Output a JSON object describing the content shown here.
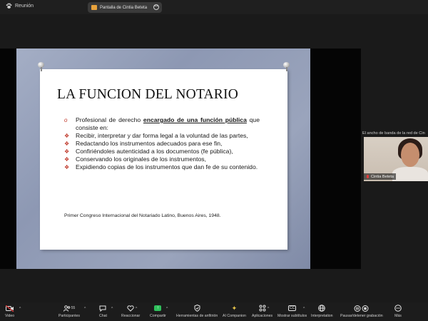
{
  "topbar": {
    "meeting_title": "Reunión",
    "share_label": "Pantalla de Cintia Beteta"
  },
  "slide": {
    "title": "LA FUNCION DEL NOTARIO",
    "bullets": [
      {
        "marker": "o",
        "pre": "Profesional de derecho ",
        "bold": "encargado de una función pública",
        "post": " que consiste en:"
      },
      {
        "marker": "❖",
        "text": "Recibir, interpretar y dar forma legal a la voluntad de las partes,"
      },
      {
        "marker": "❖",
        "text": "Redactando los instrumentos adecuados para ese fin,"
      },
      {
        "marker": "❖",
        "text": "Confiriéndoles autenticidad a los documentos (fe pública),"
      },
      {
        "marker": "❖",
        "text": "Conservando los originales de los instrumentos,"
      },
      {
        "marker": "❖",
        "text": "Expidiendo copias de los instrumentos que dan fe de su contenido."
      }
    ],
    "citation": "Primer Congreso Internacional del Notariado Latino, Buenos Aires, 1948."
  },
  "participant_panel": {
    "bandwidth_notice": "El ancho de banda de la red de Cin",
    "participant_name": "Cintia Beteta"
  },
  "toolbar": {
    "video": "Video",
    "participants": "Participantes",
    "participants_count": "55",
    "chat": "Chat",
    "reactions": "Reaccionar",
    "share": "Compartir",
    "host_tools": "Herramientas de anfitrión",
    "ai_companion": "AI Companion",
    "apps": "Aplicaciones",
    "captions": "Mostrar subtítulos",
    "interpretation": "Interpretation",
    "recording": "Pausar/detener grabación",
    "more": "Más"
  },
  "colors": {
    "accent_bullet": "#c0392b",
    "share_green": "#2fbf5b",
    "mic_off_red": "#e23b3b"
  }
}
